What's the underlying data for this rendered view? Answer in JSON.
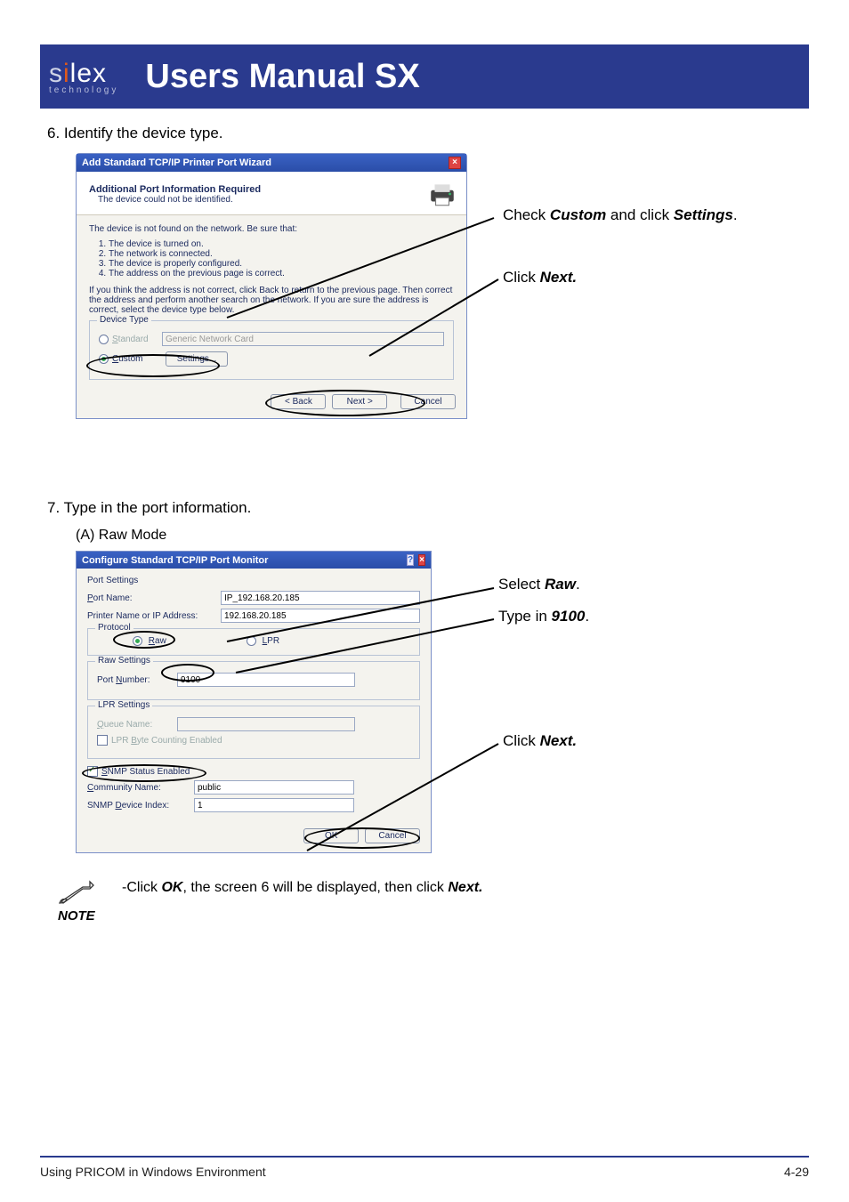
{
  "banner": {
    "title": "Users Manual SX",
    "logo_main_pre": "s",
    "logo_main_i": "i",
    "logo_main_post": "lex",
    "logo_sub": "technology"
  },
  "step6": {
    "text": "6. Identify the device type."
  },
  "step7": {
    "text": "7. Type in the port information.",
    "sub": "(A) Raw Mode"
  },
  "dlg1": {
    "title": "Add Standard TCP/IP Printer Port Wizard",
    "head_t1": "Additional Port Information Required",
    "head_t2": "The device could not be identified.",
    "body_p1": "The device is not found on the network.  Be sure that:",
    "body_li1": "The device is turned on.",
    "body_li2": "The network is connected.",
    "body_li3": "The device is properly configured.",
    "body_li4": "The address on the previous page is correct.",
    "body_p2": "If you think the address is not correct, click Back to return to the previous page.  Then correct the address and perform another search on the network.  If you are sure the address is correct, select the device type below.",
    "device_type_legend": "Device Type",
    "dt_standard": "Standard",
    "dt_standard_val": "Generic Network Card",
    "dt_custom": "Custom",
    "settings": "Settings...",
    "back": "< Back",
    "next": "Next >",
    "cancel": "Cancel"
  },
  "dlg2": {
    "title": "Configure Standard TCP/IP Port Monitor",
    "legend_ps": "Port Settings",
    "portname_l": "Port Name:",
    "portname_v": "IP_192.168.20.185",
    "printer_l": "Printer Name or IP Address:",
    "printer_v": "192.168.20.185",
    "protocol_legend": "Protocol",
    "raw": "Raw",
    "lpr": "LPR",
    "raw_legend": "Raw Settings",
    "portnum_l": "Port Number:",
    "portnum_v": "9100",
    "lpr_legend": "LPR Settings",
    "queue_l": "Queue Name:",
    "lpr_byte": "LPR Byte Counting Enabled",
    "snmp": "SNMP Status Enabled",
    "comm_l": "Community Name:",
    "comm_v": "public",
    "devidx_l": "SNMP Device Index:",
    "devidx_v": "1",
    "ok": "OK",
    "cancel": "Cancel"
  },
  "annot": {
    "a1_pre": "Check ",
    "a1_b1": "Custom",
    "a1_mid": " and click ",
    "a1_b2": "Settings",
    "a1_post": ".",
    "a2_pre": "Click ",
    "a2_b": "Next.",
    "a3_pre": "Select ",
    "a3_b": "Raw",
    "a3_post": ".",
    "a4_pre": "Type in ",
    "a4_b": "9100",
    "a4_post": ".",
    "a5_pre": "Click ",
    "a5_b": "Next."
  },
  "note": {
    "label": "NOTE",
    "text_pre": "-Click ",
    "text_b1": "OK",
    "text_mid": ", the screen 6 will be displayed, then click ",
    "text_b2": "Next."
  },
  "footer": {
    "left": "Using PRICOM in Windows Environment",
    "right": "4-29"
  }
}
